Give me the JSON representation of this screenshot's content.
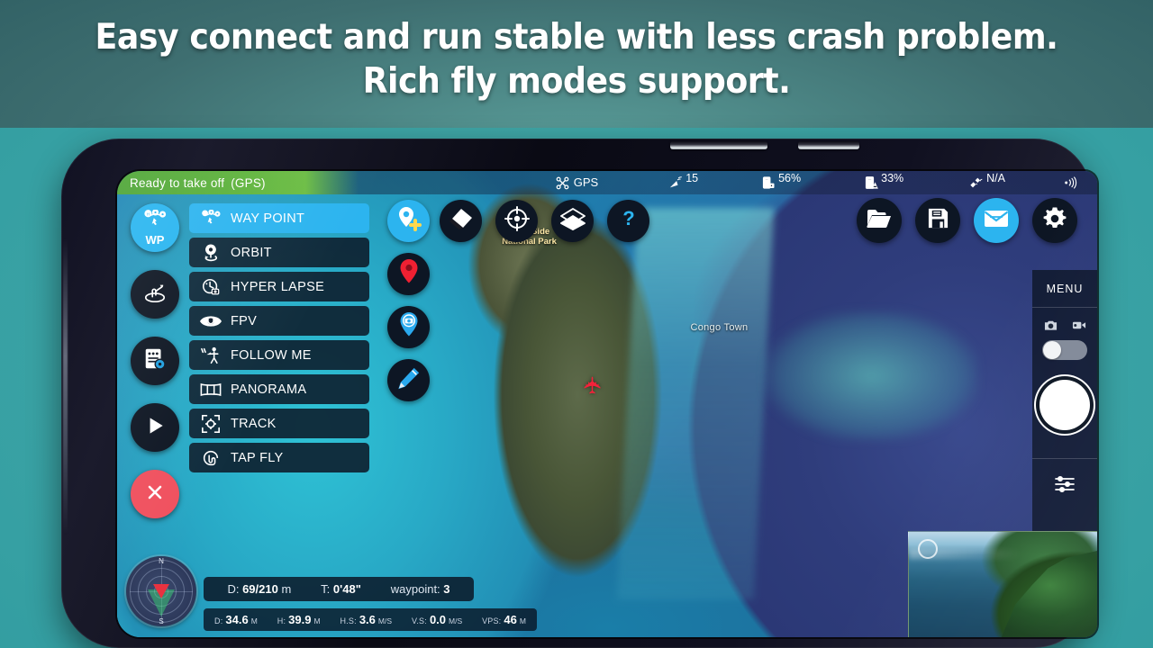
{
  "promo": {
    "headline_line1": "Easy connect and run stable with less crash problem.",
    "headline_line2": "Rich fly modes support."
  },
  "colors": {
    "accent_blue": "#2cb4ef",
    "status_green": "#5fb43c",
    "danger_red": "#f0505e",
    "panel_dark": "#0d1624",
    "text_white": "#ffffff"
  },
  "app": {
    "statusbar": {
      "ready_text": "Ready to take off",
      "ready_mode": "(GPS)",
      "items": [
        {
          "name": "gps-mode",
          "icon": "drone-icon",
          "value": "GPS"
        },
        {
          "name": "satellites",
          "icon": "satellite-dish-icon",
          "value": "15"
        },
        {
          "name": "drone-battery",
          "icon": "battery-drone-icon",
          "value": "56%"
        },
        {
          "name": "rc-battery",
          "icon": "battery-rc-icon",
          "value": "33%"
        },
        {
          "name": "gps-signal",
          "icon": "satellite-icon",
          "value": "N/A"
        },
        {
          "name": "rc-signal",
          "icon": "signal-waves-icon",
          "value": ""
        }
      ]
    },
    "rail": [
      {
        "name": "way-point-mode",
        "icon": "waypoint-icon",
        "label": "WP",
        "active": true
      },
      {
        "name": "gesture-mode",
        "icon": "gesture-icon",
        "label": "",
        "active": false
      },
      {
        "name": "settings-list",
        "icon": "list-gear-icon",
        "label": "",
        "active": false
      },
      {
        "name": "play-mission",
        "icon": "play-icon",
        "label": "",
        "active": false
      },
      {
        "name": "close-panel",
        "icon": "close-icon",
        "label": "",
        "active": false
      }
    ],
    "fly_modes": [
      {
        "label": "WAY POINT",
        "icon": "waypoint-icon",
        "selected": true
      },
      {
        "label": "ORBIT",
        "icon": "orbit-icon",
        "selected": false
      },
      {
        "label": "HYPER LAPSE",
        "icon": "hyperlapse-icon",
        "selected": false
      },
      {
        "label": "FPV",
        "icon": "fpv-eye-icon",
        "selected": false
      },
      {
        "label": "FOLLOW ME",
        "icon": "follow-me-icon",
        "selected": false
      },
      {
        "label": "PANORAMA",
        "icon": "panorama-icon",
        "selected": false
      },
      {
        "label": "TRACK",
        "icon": "track-icon",
        "selected": false
      },
      {
        "label": "TAP FLY",
        "icon": "tap-fly-icon",
        "selected": false
      }
    ],
    "map_tools_column": [
      {
        "name": "add-waypoint",
        "icon": "pin-plus-icon",
        "accent": true
      },
      {
        "name": "home-point",
        "icon": "pin-red-icon",
        "accent": false
      },
      {
        "name": "photo-point",
        "icon": "pin-camera-icon",
        "accent": false
      },
      {
        "name": "edit-route",
        "icon": "pencil-icon",
        "accent": false
      }
    ],
    "map_tools_row": [
      {
        "name": "eraser-tool",
        "icon": "eraser-icon"
      },
      {
        "name": "center-map",
        "icon": "crosshair-icon"
      },
      {
        "name": "map-layers",
        "icon": "layers-icon"
      },
      {
        "name": "help",
        "icon": "question-icon"
      }
    ],
    "top_right_buttons": [
      {
        "name": "open-mission",
        "icon": "folder-icon",
        "accent": false
      },
      {
        "name": "save-mission",
        "icon": "save-icon",
        "accent": false
      },
      {
        "name": "mail-mission",
        "icon": "mail-icon",
        "accent": true
      },
      {
        "name": "settings",
        "icon": "gear-icon",
        "accent": false
      }
    ],
    "menu_panel": {
      "title": "MENU",
      "camera_icon": "camera-icon",
      "video_icon": "video-icon",
      "toggle_state": "photo",
      "shutter": "shutter-button",
      "sliders_icon": "sliders-icon"
    },
    "telemetry_main": {
      "distance_label": "D:",
      "distance_value": "69/210",
      "distance_unit": "m",
      "time_label": "T:",
      "time_value": "0'48\"",
      "waypoint_label": "waypoint:",
      "waypoint_value": "3"
    },
    "telemetry_sub": [
      {
        "key": "D:",
        "value": "34.6",
        "unit": "M"
      },
      {
        "key": "H:",
        "value": "39.9",
        "unit": "M"
      },
      {
        "key": "H.S:",
        "value": "3.6",
        "unit": "M/S"
      },
      {
        "key": "V.S:",
        "value": "0.0",
        "unit": "M/S"
      },
      {
        "key": "VPS:",
        "value": "46",
        "unit": "M"
      }
    ],
    "radar": {
      "north_label": "N",
      "south_label": "S"
    },
    "map_labels": {
      "town": "Congo Town",
      "park_line1": "West Side",
      "park_line2": "National Park"
    }
  }
}
